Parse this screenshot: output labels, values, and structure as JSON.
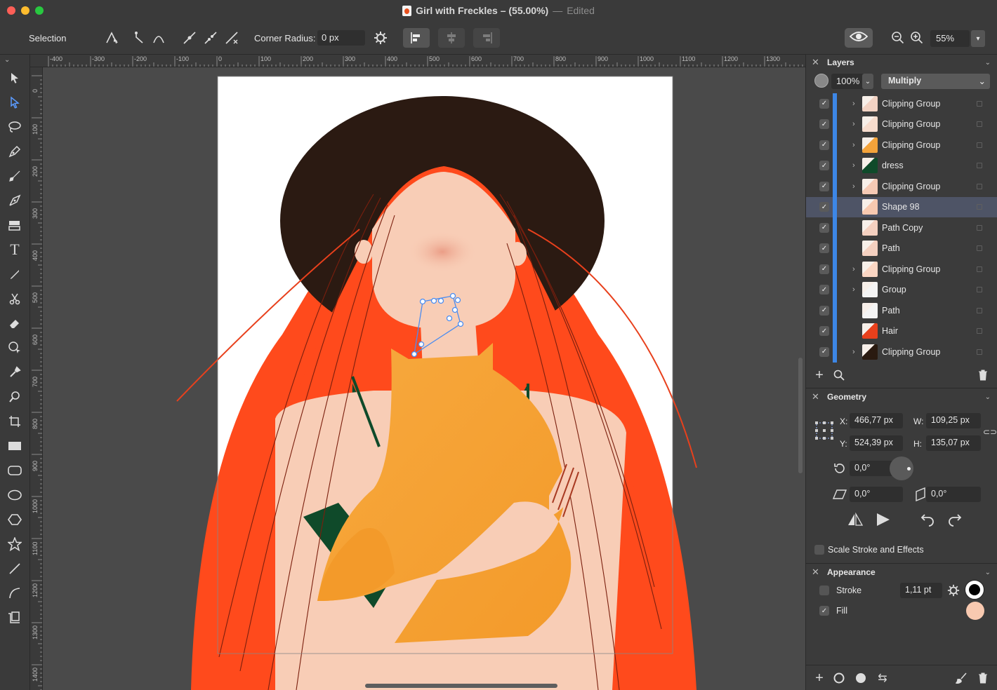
{
  "window": {
    "title": "Girl with Freckles – (55.00%)",
    "separator": "—",
    "status": "Edited"
  },
  "toolbar": {
    "mode_label": "Selection",
    "corner_radius_label": "Corner Radius:",
    "corner_radius_value": "0 px",
    "zoom_value": "55%"
  },
  "rulers": {
    "unit": "px",
    "top_ticks": [
      "-400",
      "-300",
      "-200",
      "-100",
      "0",
      "100",
      "200",
      "300",
      "400",
      "500",
      "600",
      "700",
      "800",
      "900",
      "1000",
      "1100",
      "1200",
      "1300"
    ],
    "left_ticks": [
      "0",
      "100",
      "200",
      "300",
      "400",
      "500",
      "600",
      "700",
      "800",
      "900",
      "1000",
      "1100",
      "1200",
      "1300",
      "1400"
    ]
  },
  "tools": [
    "pointer-tool",
    "subselect-tool",
    "lasso-tool",
    "pen-tool",
    "brush-tool",
    "vector-brush-tool",
    "fill-tool",
    "text-tool",
    "pencil-tool",
    "scissors-tool",
    "eraser-tool",
    "shape-builder-tool",
    "eyedropper-tool",
    "zoom-tool",
    "crop-tool",
    "rectangle-tool",
    "rounded-rectangle-tool",
    "ellipse-tool",
    "polygon-tool",
    "star-tool",
    "line-tool",
    "arc-tool",
    "artboard-tool"
  ],
  "layers": {
    "title": "Layers",
    "opacity": "100%",
    "blend_mode": "Multiply",
    "items": [
      {
        "name": "Clipping Group",
        "expandable": true,
        "selected": false,
        "thumb": "#f2d2c3"
      },
      {
        "name": "Clipping Group",
        "expandable": true,
        "selected": false,
        "thumb": "#f7dccd"
      },
      {
        "name": "Clipping Group",
        "expandable": true,
        "selected": false,
        "thumb": "#f4a33a"
      },
      {
        "name": "dress",
        "expandable": true,
        "selected": false,
        "thumb": "#0f4a2a"
      },
      {
        "name": "Clipping Group",
        "expandable": true,
        "selected": false,
        "thumb": "#f5c9b4"
      },
      {
        "name": "Shape 98",
        "expandable": false,
        "selected": true,
        "thumb": "#f8c9b0"
      },
      {
        "name": "Path Copy",
        "expandable": false,
        "selected": false,
        "thumb": "#f4d0c0"
      },
      {
        "name": "Path",
        "expandable": false,
        "selected": false,
        "thumb": "#f4d0c0"
      },
      {
        "name": "Clipping Group",
        "expandable": true,
        "selected": false,
        "thumb": "#fbd6c3"
      },
      {
        "name": "Group",
        "expandable": true,
        "selected": false,
        "thumb": "#f4f4f4"
      },
      {
        "name": "Path",
        "expandable": false,
        "selected": false,
        "thumb": "#f4f4f4"
      },
      {
        "name": "Hair",
        "expandable": false,
        "selected": false,
        "thumb": "#e8401c"
      },
      {
        "name": "Clipping Group",
        "expandable": true,
        "selected": false,
        "thumb": "#2a1a10"
      }
    ]
  },
  "geometry": {
    "title": "Geometry",
    "x_label": "X:",
    "x_value": "466,77 px",
    "y_label": "Y:",
    "y_value": "524,39 px",
    "w_label": "W:",
    "w_value": "109,25 px",
    "h_label": "H:",
    "h_value": "135,07 px",
    "rotation": "0,0°",
    "skew_h": "0,0°",
    "skew_v": "0,0°",
    "scale_stroke_label": "Scale Stroke and Effects"
  },
  "appearance": {
    "title": "Appearance",
    "stroke_label": "Stroke",
    "stroke_enabled": false,
    "stroke_width": "1,11 pt",
    "stroke_color": "#000000",
    "fill_label": "Fill",
    "fill_enabled": true,
    "fill_color": "#f8c9b0"
  }
}
